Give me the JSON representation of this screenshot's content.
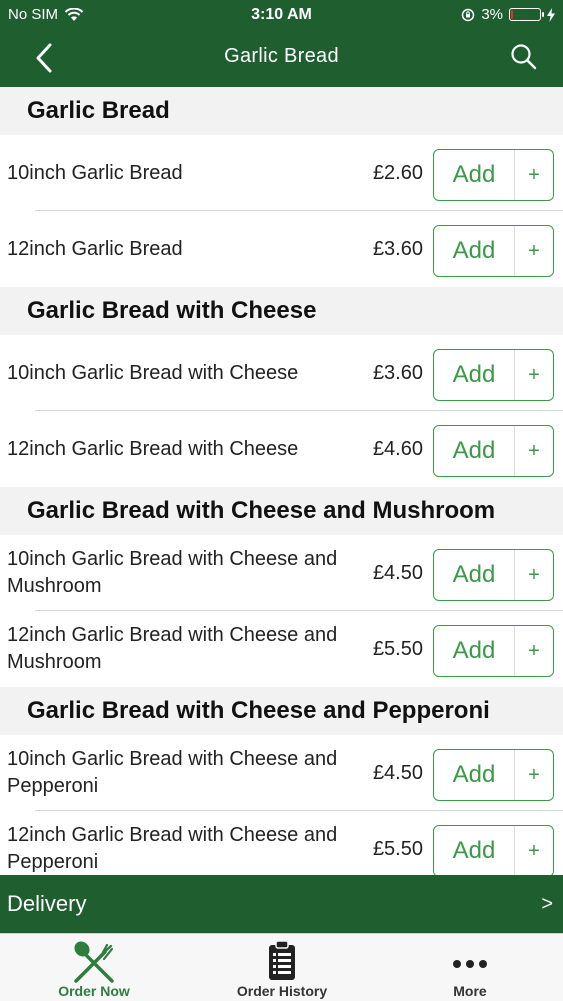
{
  "status": {
    "carrier": "No SIM",
    "time": "3:10 AM",
    "battery": "3%",
    "battery_level": 0.03
  },
  "nav": {
    "title": "Garlic Bread",
    "back_icon": "chevron-left-icon",
    "search_icon": "search-icon"
  },
  "sections": [
    {
      "title": "Garlic Bread",
      "items": [
        {
          "name": "10inch Garlic Bread",
          "price": "£2.60"
        },
        {
          "name": "12inch Garlic Bread",
          "price": "£3.60"
        }
      ]
    },
    {
      "title": "Garlic Bread with Cheese",
      "items": [
        {
          "name": "10inch Garlic Bread with Cheese",
          "price": "£3.60"
        },
        {
          "name": "12inch Garlic Bread with Cheese",
          "price": "£4.60"
        }
      ]
    },
    {
      "title": "Garlic Bread with Cheese and Mushroom",
      "items": [
        {
          "name": "10inch Garlic Bread with Cheese and Mushroom",
          "price": "£4.50"
        },
        {
          "name": "12inch Garlic Bread with Cheese and Mushroom",
          "price": "£5.50"
        }
      ]
    },
    {
      "title": "Garlic Bread with Cheese and Pepperoni",
      "items": [
        {
          "name": "10inch Garlic Bread with Cheese and Pepperoni",
          "price": "£4.50"
        },
        {
          "name": "12inch Garlic Bread with Cheese and Pepperoni",
          "price": "£5.50"
        }
      ]
    }
  ],
  "add_button": {
    "label": "Add",
    "plus": "+"
  },
  "delivery": {
    "label": "Delivery",
    "arrow": ">"
  },
  "tabs": [
    {
      "label": "Order Now",
      "icon": "fork-knife-icon",
      "active": true
    },
    {
      "label": "Order History",
      "icon": "clipboard-list-icon",
      "active": false
    },
    {
      "label": "More",
      "icon": "more-dots-icon",
      "active": false
    }
  ],
  "colors": {
    "brand_green": "#1e5e2f",
    "accent_green": "#3a9a47",
    "section_bg": "#f2f2f2"
  }
}
